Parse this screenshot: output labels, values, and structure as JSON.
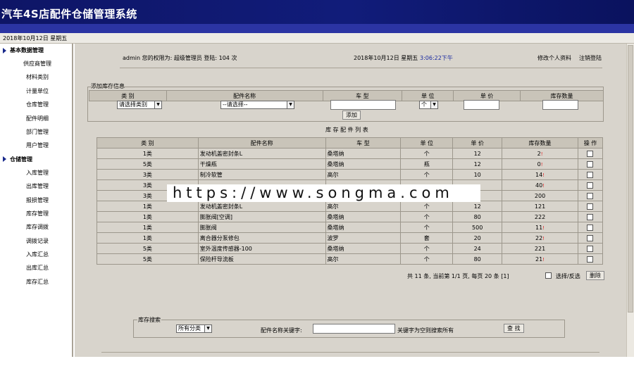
{
  "app": {
    "title": "汽车4S店配件仓储管理系统"
  },
  "datebar": {
    "text": "2018年10月12日   星期五"
  },
  "sidebar": {
    "sections": [
      {
        "title": "基本数据管理",
        "items": [
          "供应商管理",
          "材料类别",
          "计量单位",
          "仓库管理",
          "配件明细",
          "部门管理",
          "用户管理"
        ]
      },
      {
        "title": "仓储管理",
        "items": [
          "入库管理",
          "出库管理",
          "报损管理",
          "库存管理",
          "库存调拨",
          "调拨记录",
          "入库汇总",
          "出库汇总",
          "库存汇总"
        ]
      }
    ]
  },
  "topinfo": {
    "user": "admin  您的权限为: 超级管理员  登陆: 104 次",
    "date": "2018年10月12日  星期五",
    "time": "3:06:22下午",
    "edit_profile": "修改个人资料",
    "logout": "注销登陆"
  },
  "add_form": {
    "legend": "添加库存信息",
    "headers": [
      "类 别",
      "配件名称",
      "车 型",
      "单 位",
      "单 价",
      "库存数量"
    ],
    "category_select": "请选择类别",
    "part_select": "--请选择--",
    "unit_select": "个",
    "add_button": "添加"
  },
  "list": {
    "title": "库 存 配 件 列 表",
    "headers": [
      "类 别",
      "配件名称",
      "车 型",
      "单 位",
      "单 价",
      "库存数量",
      "操 作"
    ],
    "rows": [
      {
        "cat": "1类",
        "name": "发动机盖密封条L",
        "model": "桑塔纳",
        "unit": "个",
        "price": "12",
        "qty": "2",
        "mark": "!"
      },
      {
        "cat": "5类",
        "name": "干燥瓶",
        "model": "桑塔纳",
        "unit": "瓶",
        "price": "12",
        "qty": "0",
        "mark": "!"
      },
      {
        "cat": "3类",
        "name": "制冷软管",
        "model": "高尔",
        "unit": "个",
        "price": "10",
        "qty": "14",
        "mark": "!"
      },
      {
        "cat": "3类",
        "name": "",
        "model": "",
        "unit": "",
        "price": "",
        "qty": "40",
        "mark": "!"
      },
      {
        "cat": "3类",
        "name": "",
        "model": "",
        "unit": "",
        "price": "",
        "qty": "200",
        "mark": ""
      },
      {
        "cat": "1类",
        "name": "发动机盖密封条L",
        "model": "高尔",
        "unit": "个",
        "price": "12",
        "qty": "121",
        "mark": ""
      },
      {
        "cat": "1类",
        "name": "膨胀阀[空调]",
        "model": "桑塔纳",
        "unit": "个",
        "price": "80",
        "qty": "222",
        "mark": ""
      },
      {
        "cat": "1类",
        "name": "膨胀阀",
        "model": "桑塔纳",
        "unit": "个",
        "price": "500",
        "qty": "11",
        "mark": "!"
      },
      {
        "cat": "1类",
        "name": "离合器分泵修包",
        "model": "波罗",
        "unit": "套",
        "price": "20",
        "qty": "22",
        "mark": "!"
      },
      {
        "cat": "5类",
        "name": "室外温度传感器-100",
        "model": "桑塔纳",
        "unit": "个",
        "price": "24",
        "qty": "221",
        "mark": ""
      },
      {
        "cat": "5类",
        "name": "保险杆导流板",
        "model": "高尔",
        "unit": "个",
        "price": "80",
        "qty": "21",
        "mark": "!"
      }
    ],
    "pagination": "共 11 条, 当前第 1/1 页, 每页 20 条 [1]",
    "select_toggle": "选择/反选",
    "delete_button": "删除"
  },
  "search": {
    "legend": "库存搜索",
    "category_select": "所有分类",
    "keyword_label": "配件名称关键字:",
    "hint": "关键字为空则搜索所有",
    "search_button": "查 找"
  },
  "watermark": "https://www.songma.com"
}
